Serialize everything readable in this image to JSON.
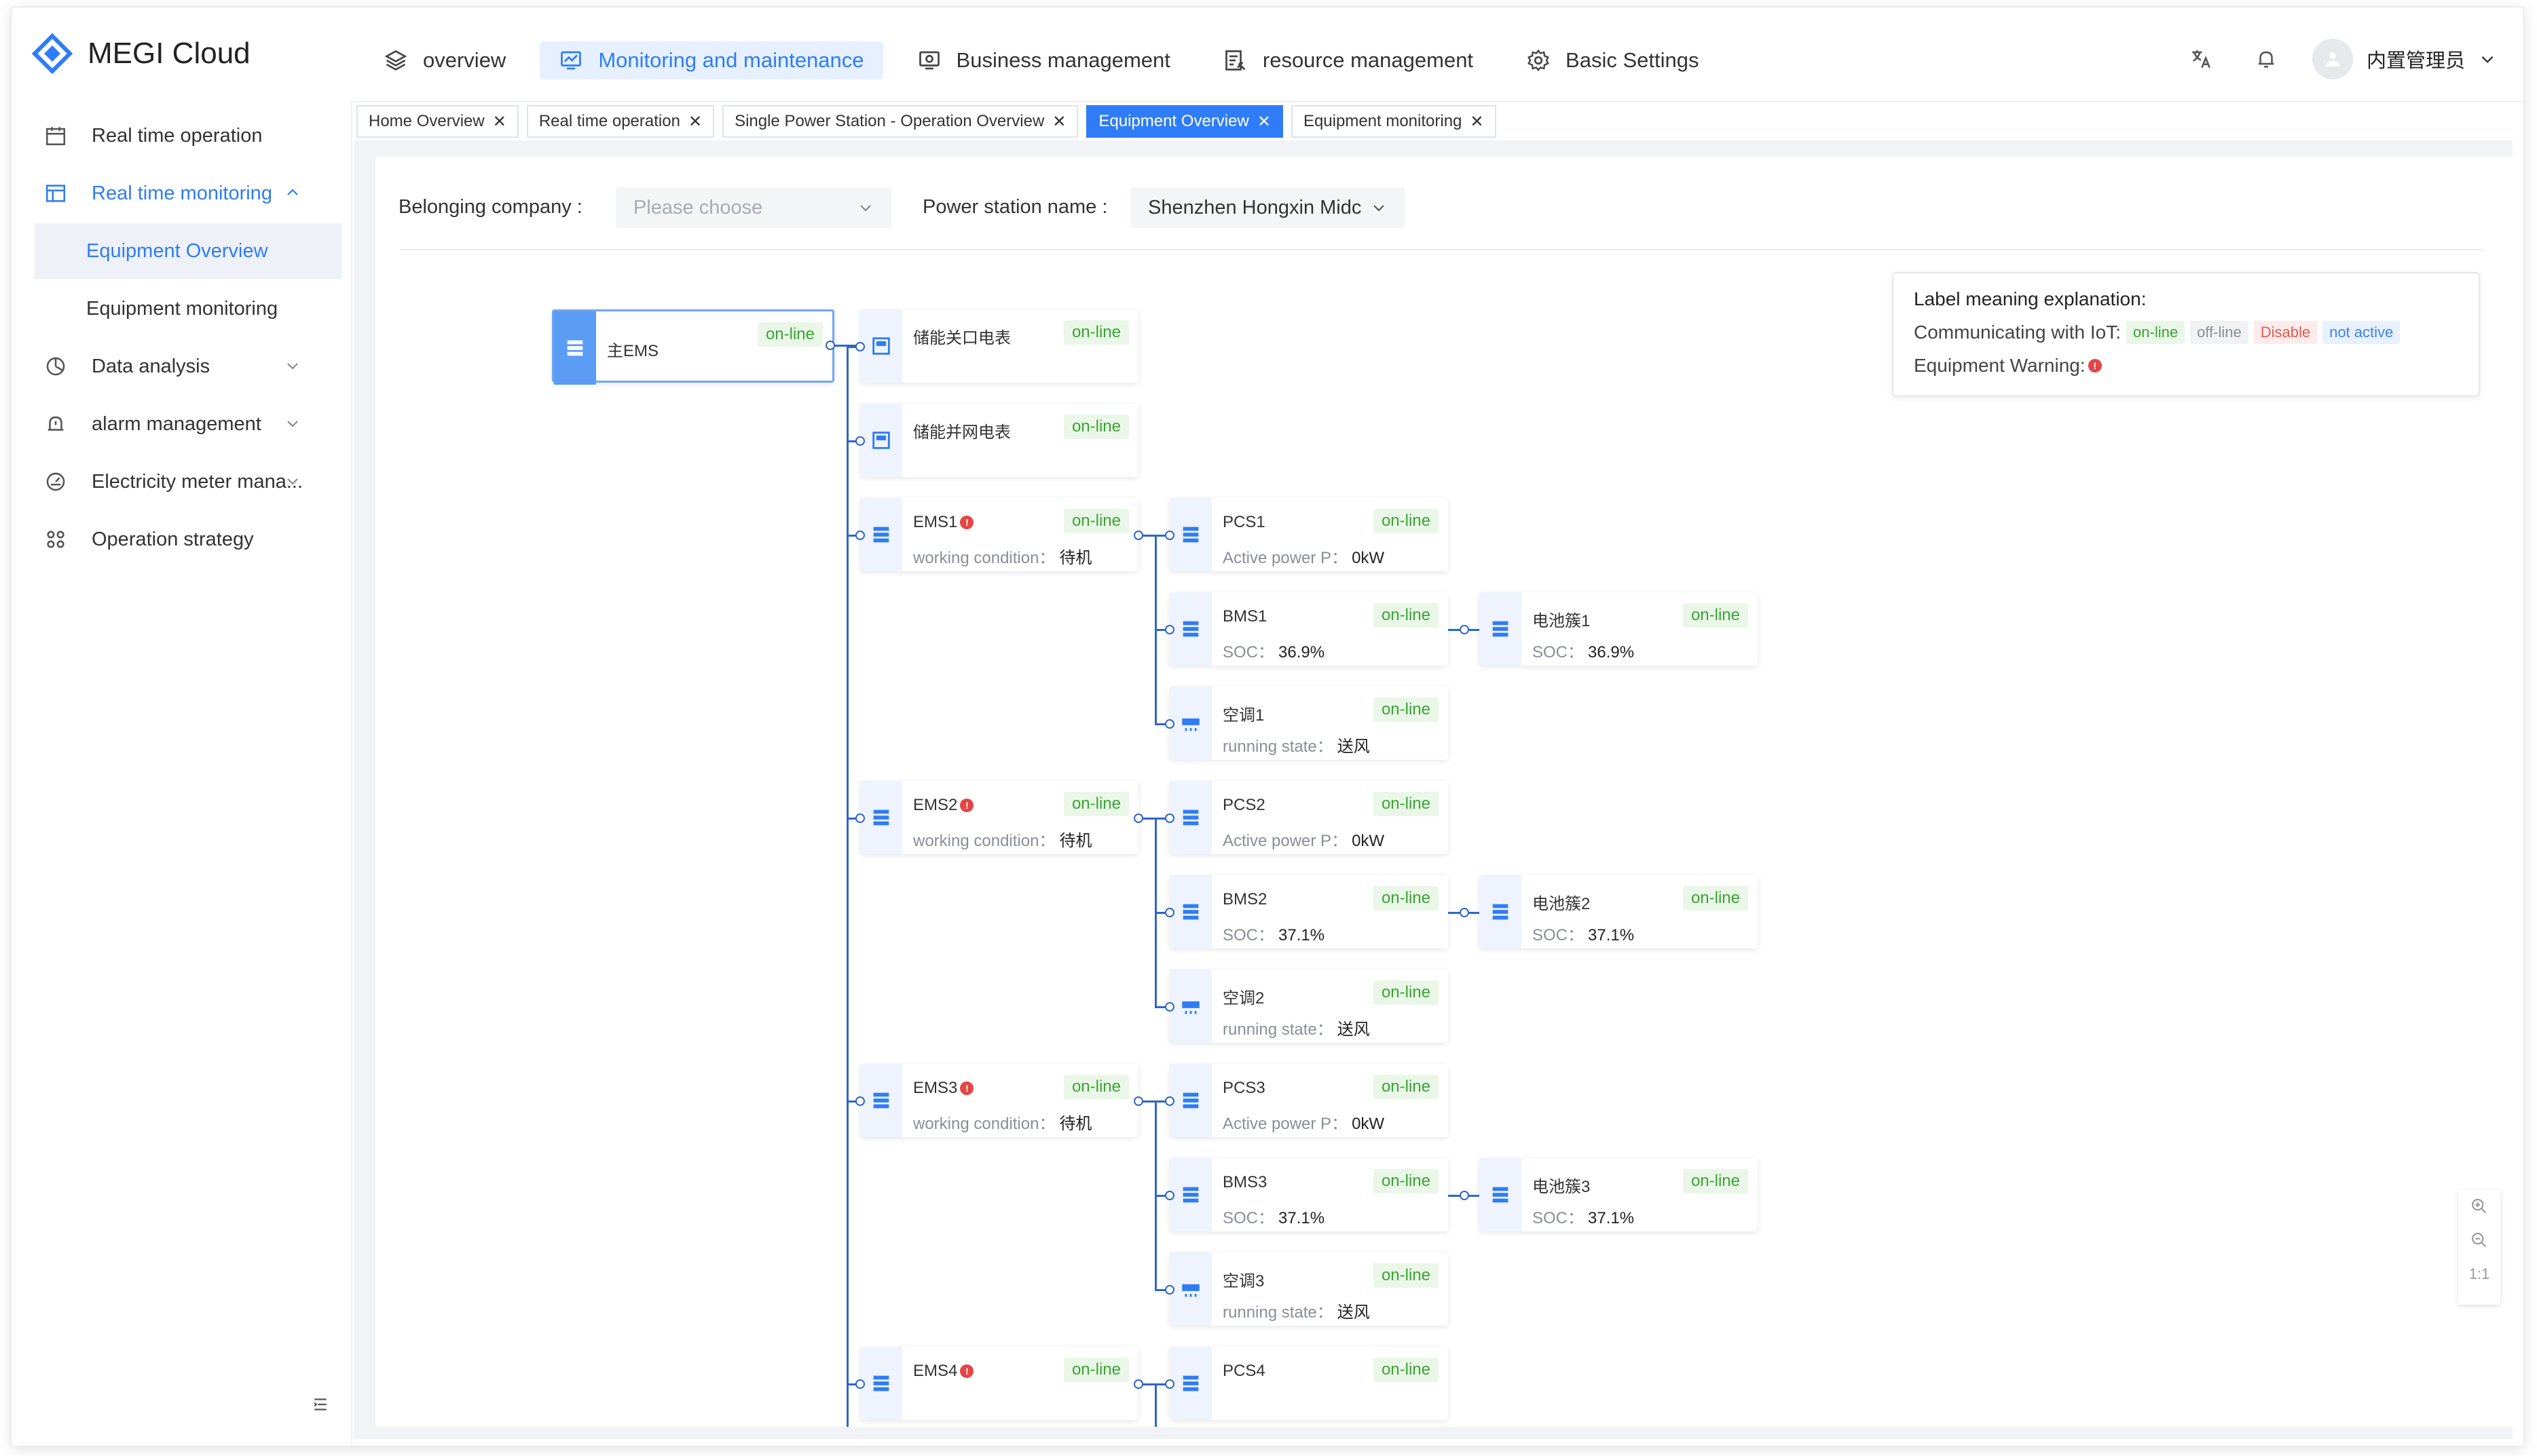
{
  "app": {
    "title": "MEGI Cloud",
    "brand_color": "#2f7cf6"
  },
  "nav": [
    {
      "label": "overview",
      "icon": "layers-icon"
    },
    {
      "label": "Monitoring and maintenance",
      "icon": "monitor-chart-icon",
      "active": true
    },
    {
      "label": "Business management",
      "icon": "business-icon"
    },
    {
      "label": "resource management",
      "icon": "resource-icon"
    },
    {
      "label": "Basic Settings",
      "icon": "gear-icon"
    }
  ],
  "user": {
    "name": "内置管理员"
  },
  "sidebar": {
    "items": [
      {
        "label": "Real time operation",
        "icon": "calendar-icon"
      },
      {
        "label": "Real time monitoring",
        "icon": "monitor-icon",
        "expanded": true
      },
      {
        "label": "Equipment Overview",
        "sub": true,
        "active": true
      },
      {
        "label": "Equipment monitoring",
        "sub": true
      },
      {
        "label": "Data analysis",
        "icon": "pie-chart-icon"
      },
      {
        "label": "alarm management",
        "icon": "alarm-icon"
      },
      {
        "label": "Electricity meter mana...",
        "icon": "meter-icon"
      },
      {
        "label": "Operation strategy",
        "icon": "strategy-icon"
      }
    ]
  },
  "tabs": [
    {
      "label": "Home Overview"
    },
    {
      "label": "Real time operation"
    },
    {
      "label": "Single Power Station - Operation Overview"
    },
    {
      "label": "Equipment Overview",
      "active": true
    },
    {
      "label": "Equipment monitoring"
    }
  ],
  "filters": {
    "company_label": "Belonging company :",
    "company_placeholder": "Please choose",
    "station_label": "Power station name :",
    "station_value": "Shenzhen Hongxin Midc"
  },
  "legend": {
    "title": "Label meaning explanation:",
    "iot_label": "Communicating with IoT:",
    "online": "on-line",
    "offline": "off-line",
    "disable": "Disable",
    "not_active": "not active",
    "warning_label": "Equipment Warning:"
  },
  "tree": {
    "main": {
      "name": "主EMS",
      "status": "on-line"
    },
    "meters": [
      {
        "name": "储能关口电表",
        "status": "on-line"
      },
      {
        "name": "储能并网电表",
        "status": "on-line"
      }
    ],
    "ems": [
      {
        "name": "EMS1",
        "status": "on-line",
        "detail_label": "working condition：",
        "detail_value": "待机",
        "pcs": {
          "name": "PCS1",
          "status": "on-line",
          "detail_label": "Active power P：",
          "detail_value": "0kW"
        },
        "bms": {
          "name": "BMS1",
          "status": "on-line",
          "detail_label": "SOC：",
          "detail_value": "36.9%"
        },
        "cluster": {
          "name": "电池簇1",
          "status": "on-line",
          "detail_label": "SOC：",
          "detail_value": "36.9%"
        },
        "ac": {
          "name": "空调1",
          "status": "on-line",
          "detail_label": "running state：",
          "detail_value": "送风"
        }
      },
      {
        "name": "EMS2",
        "status": "on-line",
        "detail_label": "working condition：",
        "detail_value": "待机",
        "pcs": {
          "name": "PCS2",
          "status": "on-line",
          "detail_label": "Active power P：",
          "detail_value": "0kW"
        },
        "bms": {
          "name": "BMS2",
          "status": "on-line",
          "detail_label": "SOC：",
          "detail_value": "37.1%"
        },
        "cluster": {
          "name": "电池簇2",
          "status": "on-line",
          "detail_label": "SOC：",
          "detail_value": "37.1%"
        },
        "ac": {
          "name": "空调2",
          "status": "on-line",
          "detail_label": "running state：",
          "detail_value": "送风"
        }
      },
      {
        "name": "EMS3",
        "status": "on-line",
        "detail_label": "working condition：",
        "detail_value": "待机",
        "pcs": {
          "name": "PCS3",
          "status": "on-line",
          "detail_label": "Active power P：",
          "detail_value": "0kW"
        },
        "bms": {
          "name": "BMS3",
          "status": "on-line",
          "detail_label": "SOC：",
          "detail_value": "37.1%"
        },
        "cluster": {
          "name": "电池簇3",
          "status": "on-line",
          "detail_label": "SOC：",
          "detail_value": "37.1%"
        },
        "ac": {
          "name": "空调3",
          "status": "on-line",
          "detail_label": "running state：",
          "detail_value": "送风"
        }
      },
      {
        "name": "EMS4",
        "status": "on-line",
        "pcs": {
          "name": "PCS4",
          "status": "on-line"
        }
      }
    ]
  },
  "zoom": {
    "reset_label": "1:1"
  }
}
